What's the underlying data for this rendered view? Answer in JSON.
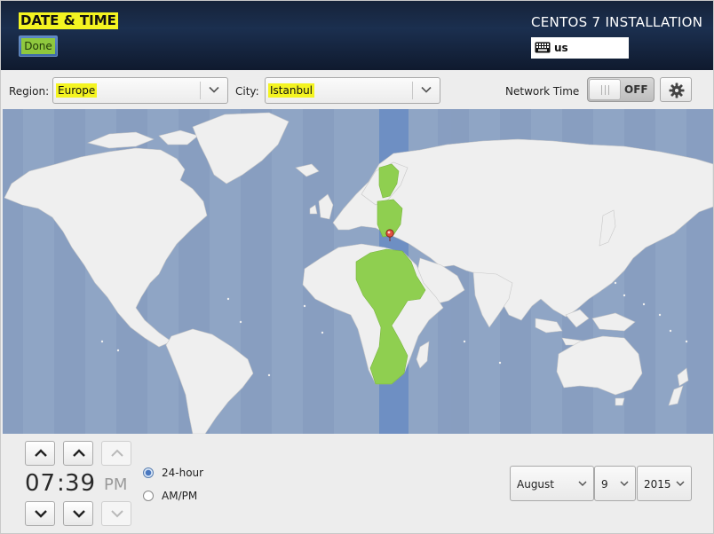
{
  "header": {
    "title": "DATE & TIME",
    "done_label": "Done",
    "install_title": "CENTOS 7 INSTALLATION",
    "keyboard_layout": "us"
  },
  "location": {
    "region_label": "Region:",
    "region_value": "Europe",
    "city_label": "City:",
    "city_value": "Istanbul"
  },
  "network_time": {
    "label": "Network Time",
    "state": "OFF"
  },
  "time": {
    "hours": "07",
    "minutes": "39",
    "ampm": "PM",
    "format_24h_label": "24-hour",
    "format_ampm_label": "AM/PM",
    "selected_format": "24-hour"
  },
  "date": {
    "month": "August",
    "day": "9",
    "year": "2015"
  },
  "colors": {
    "header_bg": "#1b2f4f",
    "highlight": "#f4f421",
    "ocean": "#8fa5c5",
    "land": "#efefef",
    "timezone_highlight": "#8fcf50",
    "timezone_band": "#6e8fc3",
    "done_button": "#8fc83e"
  },
  "icons": {
    "keyboard": "keyboard-icon",
    "dropdown": "chevron-down-icon",
    "settings": "gear-icon",
    "location_pin": "map-pin-icon",
    "increment": "chevron-up-icon",
    "decrement": "chevron-down-icon"
  }
}
